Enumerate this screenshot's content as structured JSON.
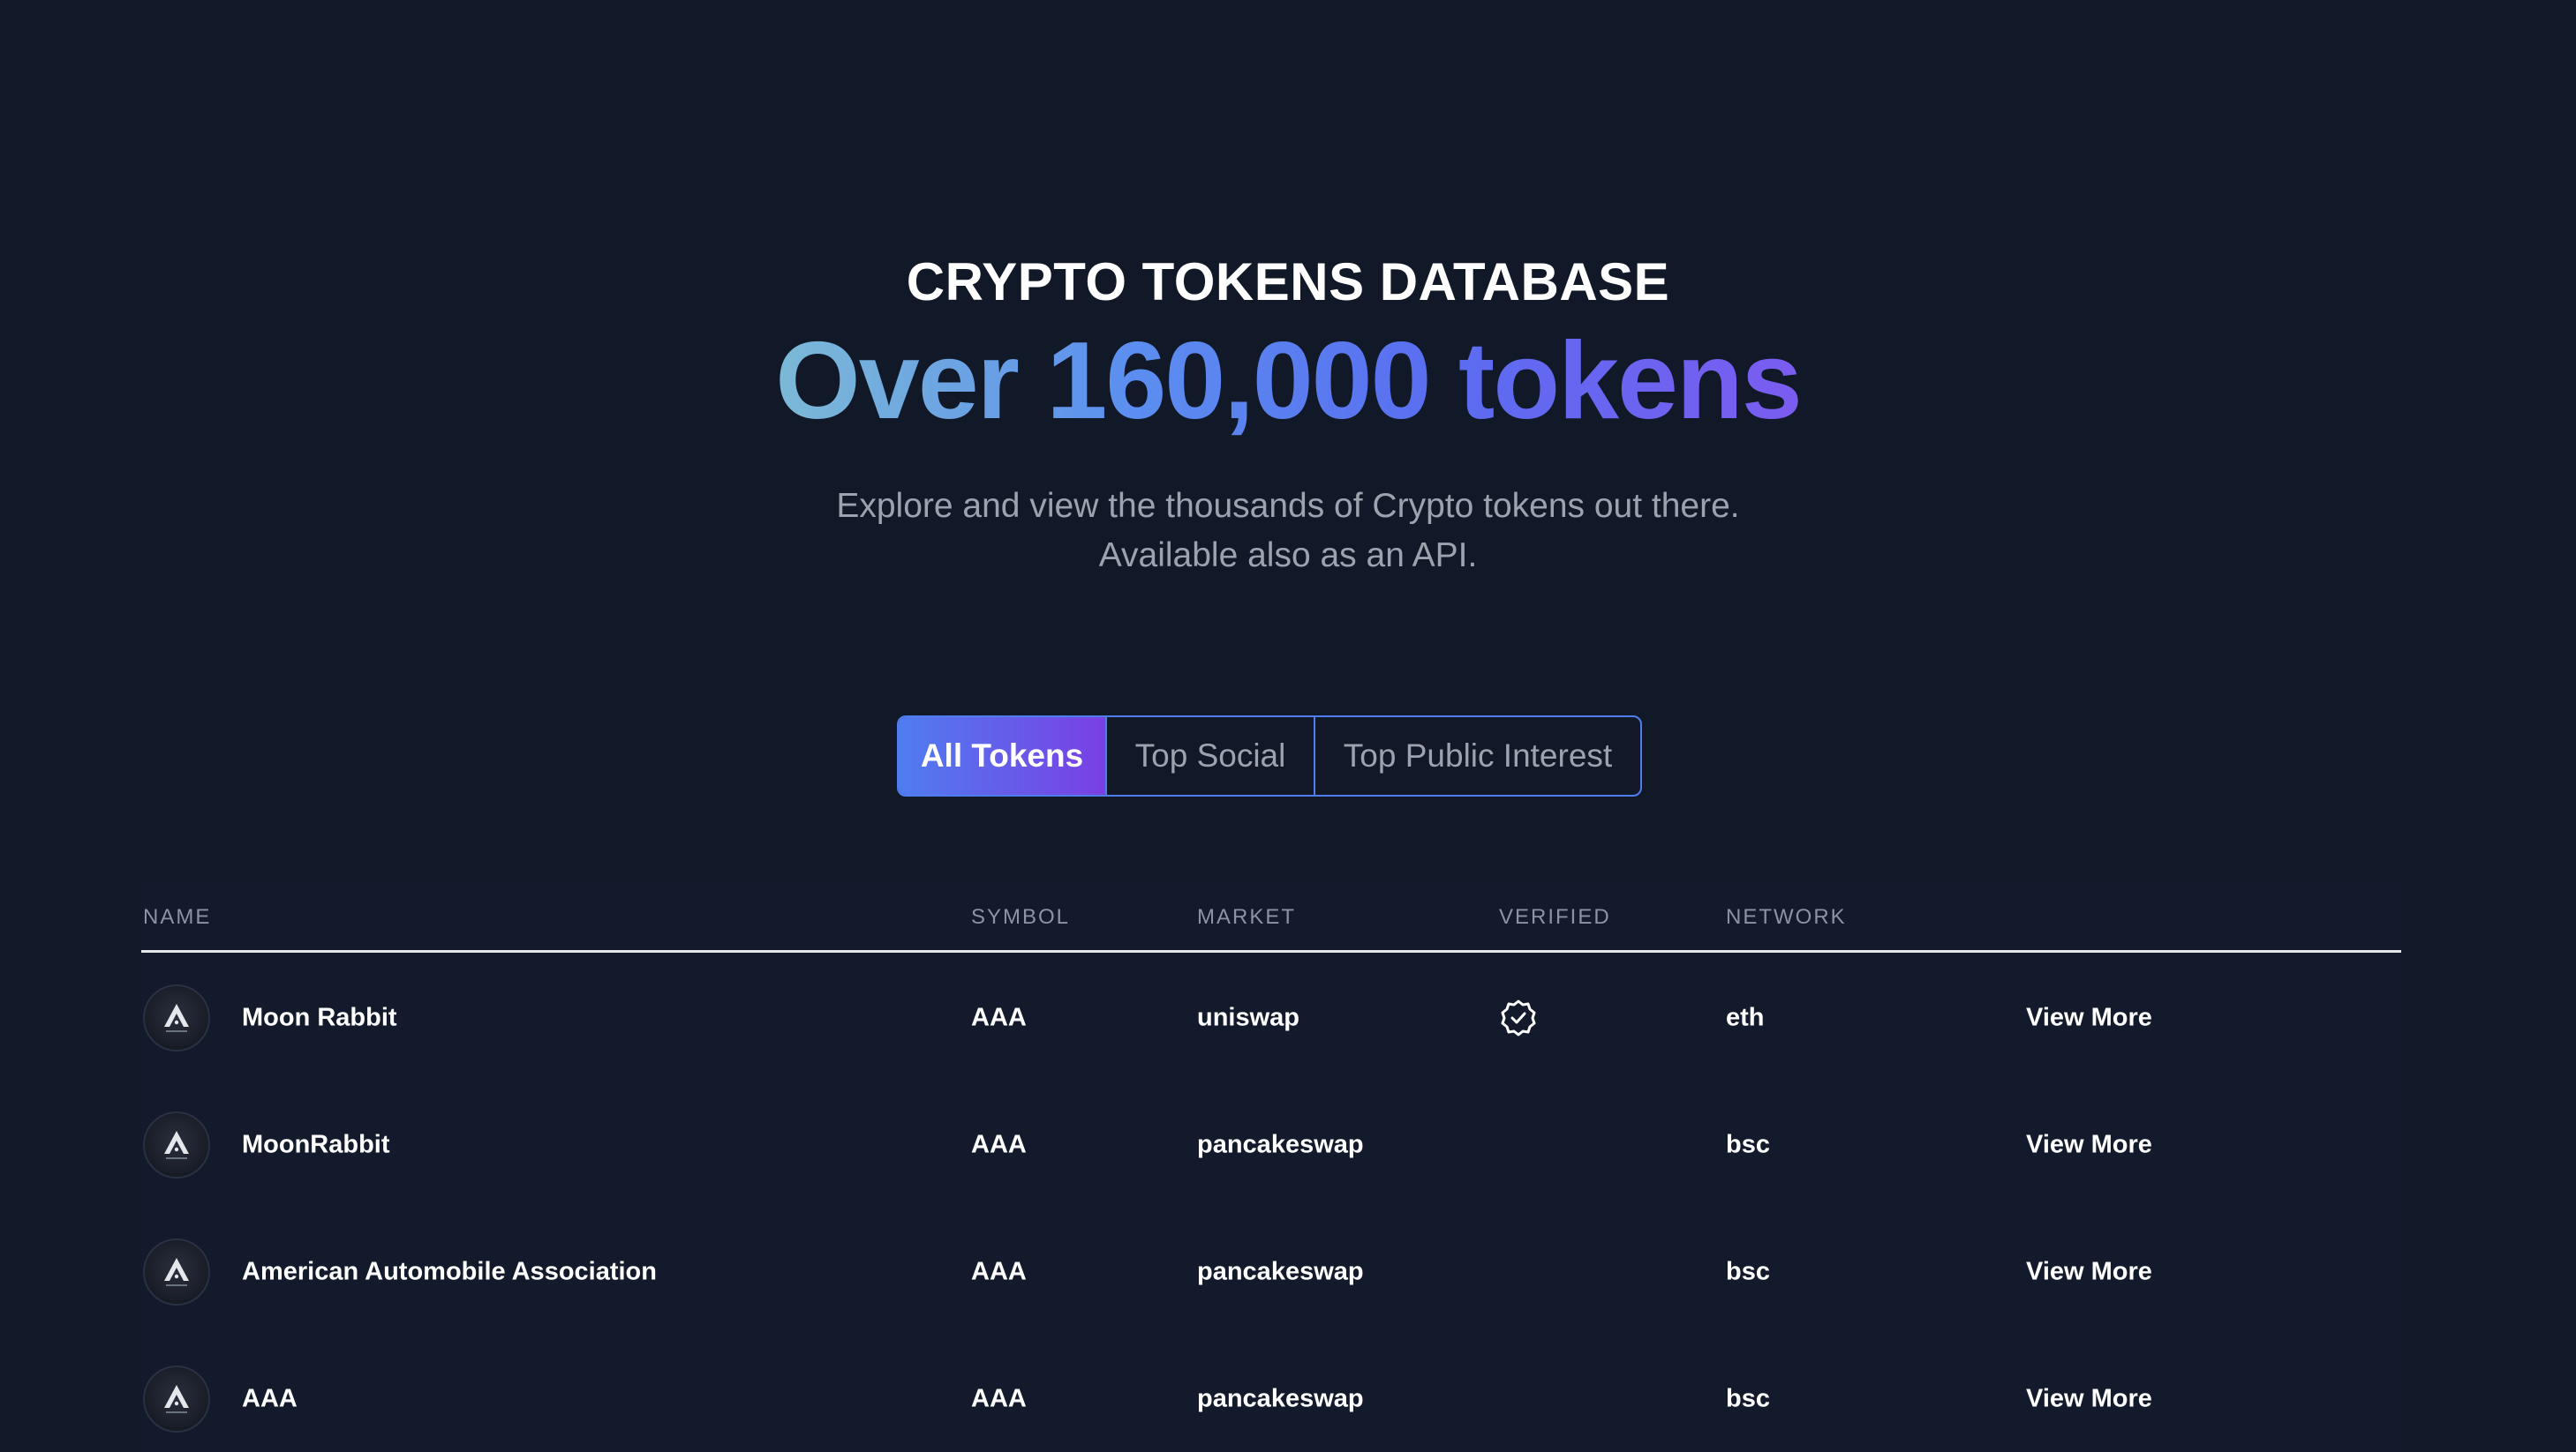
{
  "hero": {
    "eyebrow": "CRYPTO TOKENS DATABASE",
    "headline": "Over 160,000 tokens",
    "subline_1": "Explore and view the thousands of Crypto tokens out there.",
    "subline_2": "Available also as an API."
  },
  "tabs": [
    {
      "label": "All Tokens",
      "active": true
    },
    {
      "label": "Top Social",
      "active": false
    },
    {
      "label": "Top Public Interest",
      "active": false
    }
  ],
  "table": {
    "columns": [
      "NAME",
      "SYMBOL",
      "MARKET",
      "VERIFIED",
      "NETWORK"
    ],
    "rows": [
      {
        "name": "Moon Rabbit",
        "symbol": "AAA",
        "market": "uniswap",
        "verified": true,
        "network": "eth",
        "action": "View More",
        "icon": "token-logo-icon"
      },
      {
        "name": "MoonRabbit",
        "symbol": "AAA",
        "market": "pancakeswap",
        "verified": false,
        "network": "bsc",
        "action": "View More",
        "icon": "token-logo-icon"
      },
      {
        "name": "American Automobile Association",
        "symbol": "AAA",
        "market": "pancakeswap",
        "verified": false,
        "network": "bsc",
        "action": "View More",
        "icon": "token-logo-icon"
      },
      {
        "name": "AAA",
        "symbol": "AAA",
        "market": "pancakeswap",
        "verified": false,
        "network": "bsc",
        "action": "View More",
        "icon": "token-logo-icon"
      }
    ]
  },
  "colors": {
    "background": "#111827",
    "accent_blue": "#4f7df0",
    "accent_purple": "#7a3fe4",
    "muted_text": "#9ca3af"
  }
}
